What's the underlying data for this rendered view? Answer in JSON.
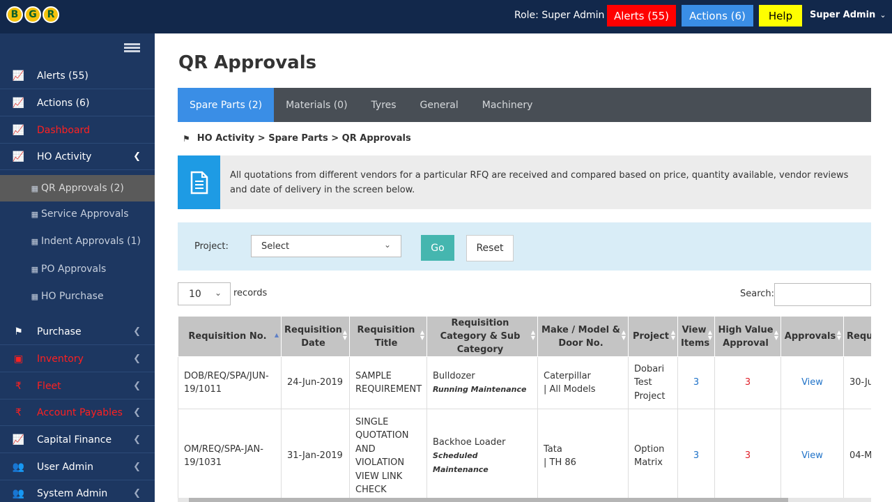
{
  "topbar": {
    "logo": [
      "B",
      "G",
      "R"
    ],
    "role": "Role: Super Admin",
    "alerts_label": "Alerts (55)",
    "actions_label": "Actions (6)",
    "help_label": "Help",
    "user_label": "Super Admin",
    "colors": {
      "bar": "#12284b",
      "alerts": "#ff0000",
      "actions": "#3a8ee6",
      "help": "#ffff00"
    }
  },
  "sidebar": {
    "items": [
      {
        "label": "Alerts (55)",
        "icon": "chart-icon"
      },
      {
        "label": "Actions (6)",
        "icon": "chart-icon"
      },
      {
        "label": "Dashboard",
        "icon": "chart-icon"
      },
      {
        "label": "HO Activity",
        "icon": "chart-icon"
      },
      {
        "label": "Purchase",
        "icon": "flag-icon"
      },
      {
        "label": "Inventory",
        "icon": "box-icon"
      },
      {
        "label": "Fleet",
        "icon": "rupee-icon"
      },
      {
        "label": "Account Payables",
        "icon": "rupee-icon"
      },
      {
        "label": "Capital Finance",
        "icon": "chart-icon"
      },
      {
        "label": "User Admin",
        "icon": "users-icon"
      },
      {
        "label": "System Admin",
        "icon": "users-icon"
      }
    ],
    "subitems": [
      {
        "label": "QR Approvals (2)"
      },
      {
        "label": "Service Approvals"
      },
      {
        "label": "Indent Approvals (1)"
      },
      {
        "label": "PO Approvals"
      },
      {
        "label": "HO Purchase"
      }
    ]
  },
  "main": {
    "title": "QR Approvals",
    "tabs": [
      "Spare Parts (2)",
      "Materials (0)",
      "Tyres",
      "General",
      "Machinery"
    ],
    "breadcrumb": "HO Activity > Spare Parts > QR Approvals",
    "info": "All quotations from different vendors for a particular RFQ are received and compared based on price, quantity available, vendor reviews and date of delivery in the screen below.",
    "filter": {
      "project_label": "Project:",
      "project_value": "Select",
      "go_label": "Go",
      "reset_label": "Reset"
    },
    "records_value": "10",
    "records_label": "records",
    "search_label": "Search:",
    "table": {
      "headers": [
        "Requisition No.",
        "Requisition Date",
        "Requisition Title",
        "Requisition Category & Sub Category",
        "Make / Model & Door No.",
        "Project",
        "View Items",
        "High Value Approval",
        "Approvals",
        "Requ"
      ],
      "rows": [
        {
          "req_no": "DOB/REQ/SPA/JUN-19/1011",
          "date": "24-Jun-2019",
          "title": "SAMPLE REQUIREMENT",
          "category": "Bulldozer",
          "subcategory": "Running Maintenance",
          "make": "Caterpillar",
          "model": "| All Models",
          "project": "Dobari Test Project",
          "view_items": "3",
          "high_value": "3",
          "approvals": "View",
          "req_extra": "30-Ju"
        },
        {
          "req_no": "OM/REQ/SPA-JAN-19/1031",
          "date": "31-Jan-2019",
          "title": "SINGLE QUOTATION AND VIOLATION VIEW LINK CHECK",
          "category": "Backhoe Loader",
          "subcategory": "Scheduled Maintenance",
          "make": "Tata",
          "model": "| TH 86",
          "project": "Option Matrix",
          "view_items": "3",
          "high_value": "3",
          "approvals": "View",
          "req_extra": "04-M"
        }
      ]
    }
  }
}
